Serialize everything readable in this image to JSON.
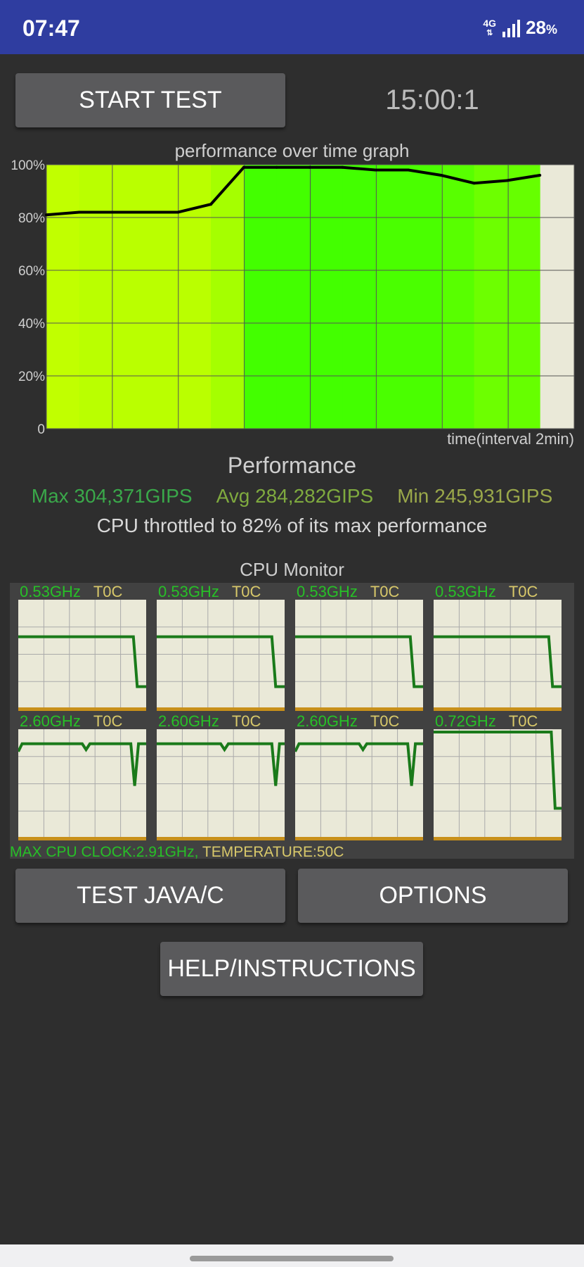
{
  "status": {
    "time": "07:47",
    "network": "4G",
    "battery": "28",
    "battery_unit": "%"
  },
  "controls": {
    "start_label": "START TEST",
    "timer": "15:00:1",
    "test_label": "TEST JAVA/C",
    "options_label": "OPTIONS",
    "help_label": "HELP/INSTRUCTIONS"
  },
  "graph": {
    "title": "performance over time graph",
    "time_label": "time(interval 2min)"
  },
  "chart_data": {
    "type": "line",
    "title": "performance over time graph",
    "xlabel": "time(interval 2min)",
    "ylabel": "",
    "ylim": [
      0,
      100
    ],
    "y_ticks": [
      "0",
      "20%",
      "40%",
      "60%",
      "80%",
      "100%"
    ],
    "grid": true,
    "x": [
      0,
      1,
      2,
      3,
      4,
      5,
      6,
      7,
      8,
      9,
      10,
      11,
      12,
      13,
      14,
      15
    ],
    "series": [
      {
        "values": [
          81,
          82,
          82,
          82,
          82,
          85,
          99,
          99,
          99,
          99,
          98,
          98,
          96,
          93,
          94,
          96
        ]
      }
    ]
  },
  "performance": {
    "heading": "Performance",
    "max": "Max 304,371GIPS",
    "avg": "Avg 284,282GIPS",
    "min": "Min 245,931GIPS",
    "throttle": "CPU throttled to 82% of its max performance"
  },
  "cpu_monitor": {
    "title": "CPU Monitor",
    "cores": [
      {
        "freq": "0.53GHz",
        "temp": "T0C"
      },
      {
        "freq": "0.53GHz",
        "temp": "T0C"
      },
      {
        "freq": "0.53GHz",
        "temp": "T0C"
      },
      {
        "freq": "0.53GHz",
        "temp": "T0C"
      },
      {
        "freq": "2.60GHz",
        "temp": "T0C"
      },
      {
        "freq": "2.60GHz",
        "temp": "T0C"
      },
      {
        "freq": "2.60GHz",
        "temp": "T0C"
      },
      {
        "freq": "0.72GHz",
        "temp": "T0C"
      }
    ],
    "footer_clock": "MAX CPU CLOCK:2.91GHz,",
    "footer_temp": "TEMPERATURE:50C"
  },
  "colors": {
    "status_bar": "#2f3da0",
    "graph_bg": "#eae9d8",
    "line": "#1a7a1a",
    "green": "#27c027",
    "yellow": "#d8c86a"
  }
}
